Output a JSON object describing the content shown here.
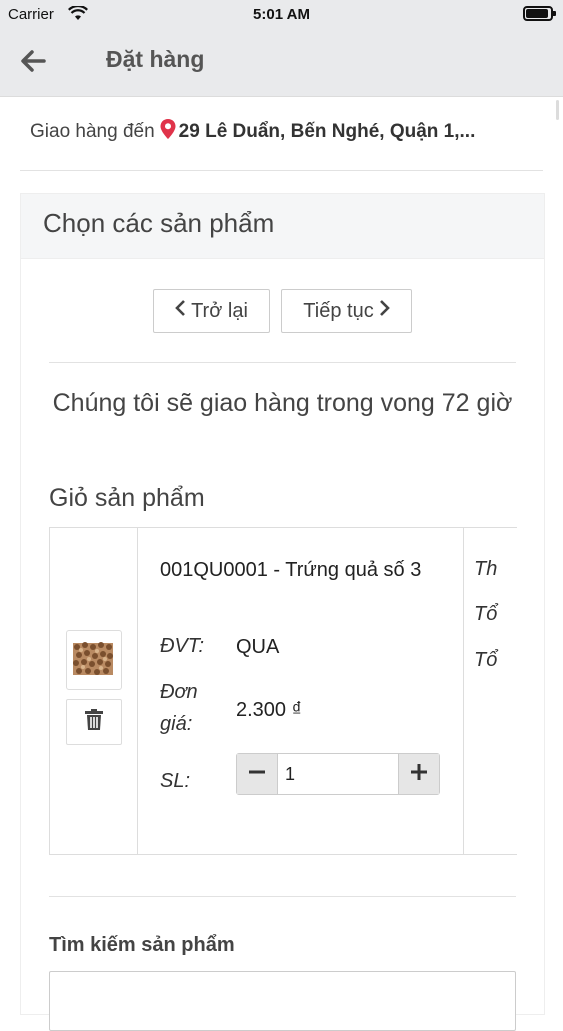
{
  "status_bar": {
    "carrier": "Carrier",
    "time": "5:01 AM"
  },
  "nav": {
    "title": "Đặt hàng"
  },
  "delivery": {
    "label": "Giao hàng đến",
    "address": "29 Lê Duẩn, Bến Nghé, Quận 1,..."
  },
  "panel": {
    "title": "Chọn các sản phẩm"
  },
  "buttons": {
    "back": "Trở lại",
    "next": "Tiếp tục"
  },
  "notice": "Chúng tôi sẽ giao hàng trong vong 72 giờ",
  "cart": {
    "title": "Giỏ sản phẩm",
    "item": {
      "name": "001QU0001 - Trứng quả số 3",
      "unit_label": "ĐVT:",
      "unit_value": "QUA",
      "price_label": "Đơn giá:",
      "price_value": "2.300 ₫",
      "qty_label": "SL:",
      "qty_value": "1",
      "extra_labels": [
        "Th",
        "Tổ",
        "Tổ"
      ]
    }
  },
  "search": {
    "label": "Tìm kiếm sản phẩm",
    "placeholder": ""
  },
  "colors": {
    "accent_pin": "#e0334a",
    "nav_bg": "#e9eaec"
  },
  "icons": [
    "back-arrow-icon",
    "location-pin-icon",
    "chevron-left-icon",
    "chevron-right-icon",
    "trash-icon",
    "minus-icon",
    "plus-icon",
    "wifi-icon",
    "battery-icon"
  ]
}
